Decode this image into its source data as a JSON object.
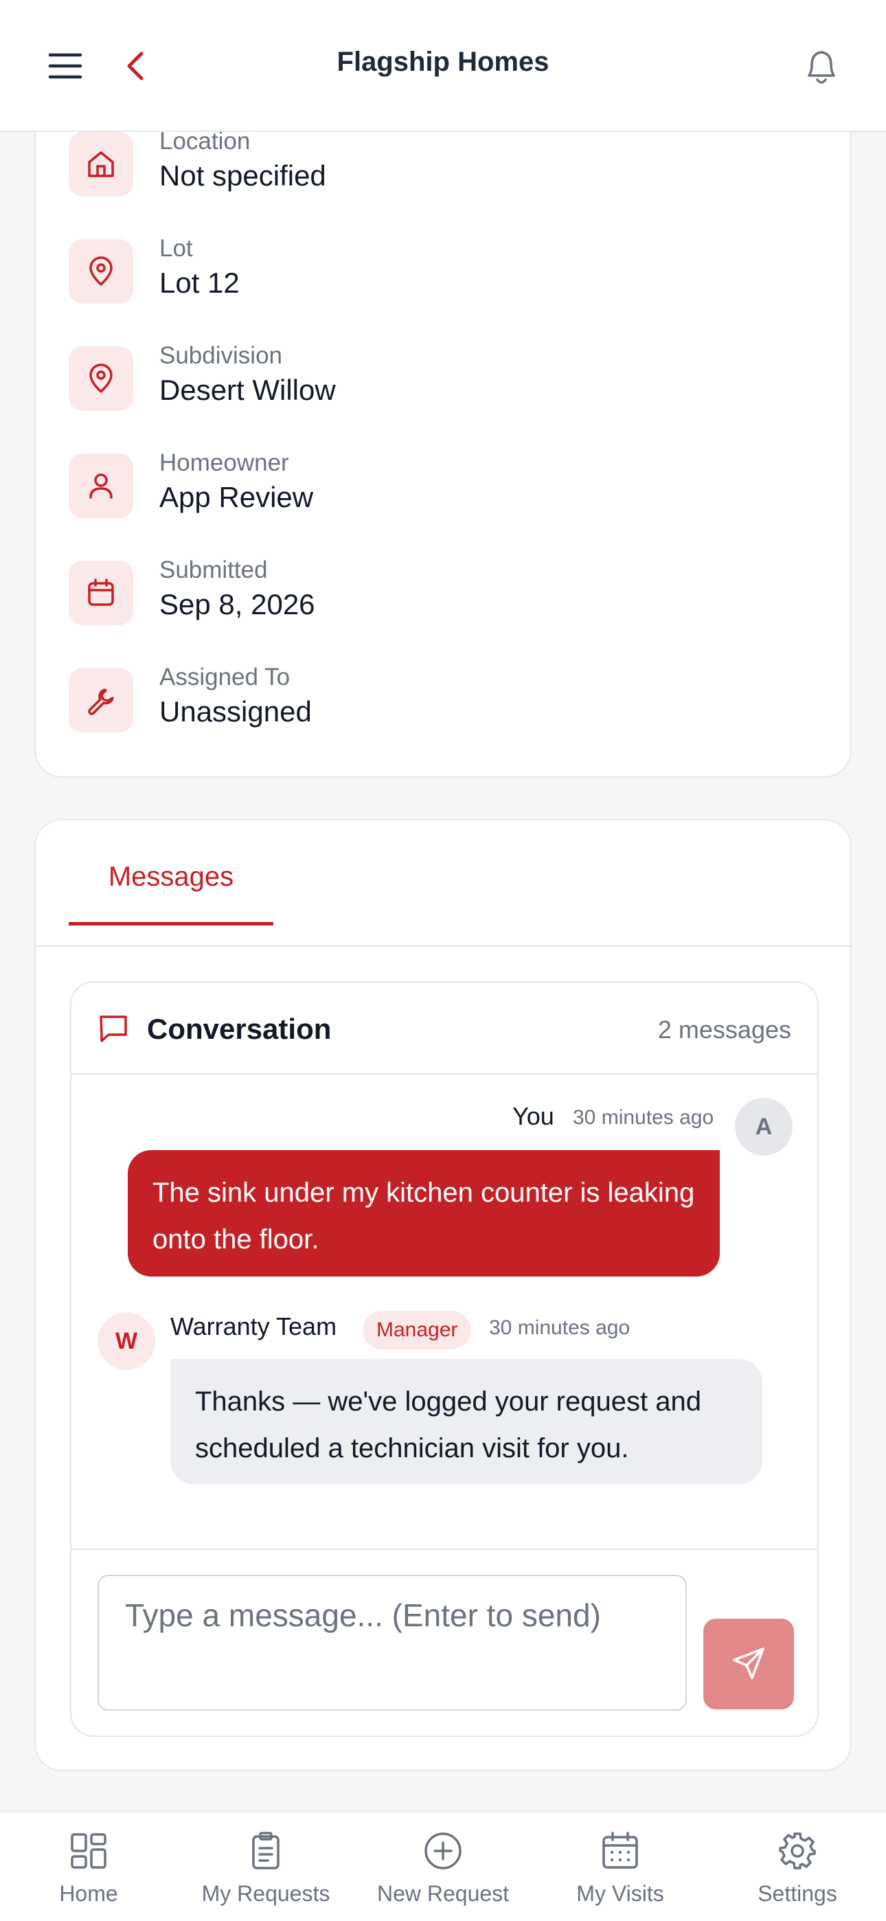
{
  "header": {
    "title": "Flagship Homes",
    "menu_icon": "hamburger-icon",
    "back_icon": "chevron-left-icon",
    "bell_icon": "bell-icon"
  },
  "details": [
    {
      "label": "Location",
      "value": "Not specified",
      "icon": "home-icon"
    },
    {
      "label": "Lot",
      "value": "Lot 12",
      "icon": "map-pin-icon"
    },
    {
      "label": "Subdivision",
      "value": "Desert Willow",
      "icon": "map-pin-icon"
    },
    {
      "label": "Homeowner",
      "value": "App Review",
      "icon": "user-icon"
    },
    {
      "label": "Submitted",
      "value": "Sep 8, 2026",
      "icon": "calendar-icon"
    },
    {
      "label": "Assigned To",
      "value": "Unassigned",
      "icon": "wrench-icon"
    }
  ],
  "messages": {
    "tab_label": "Messages",
    "conversation": {
      "title": "Conversation",
      "count": "2 messages",
      "icon": "message-square-icon"
    },
    "items": [
      {
        "sender": "You",
        "time": "30 minutes ago",
        "avatar": "A",
        "text": "The sink under my kitchen counter is leaking onto the floor."
      },
      {
        "sender": "Warranty Team",
        "role": "Manager",
        "time": "30 minutes ago",
        "avatar": "W",
        "text": "Thanks — we've logged your request and scheduled a technician visit for you."
      }
    ],
    "input_placeholder": "Type a message... (Enter to send)",
    "send_icon": "send-icon"
  },
  "nav": [
    {
      "label": "Home",
      "icon": "dashboard-icon"
    },
    {
      "label": "My Requests",
      "icon": "clipboard-icon"
    },
    {
      "label": "New Request",
      "icon": "plus-circle-icon"
    },
    {
      "label": "My Visits",
      "icon": "calendar-icon"
    },
    {
      "label": "Settings",
      "icon": "gear-icon"
    }
  ],
  "colors": {
    "accent": "#c42126",
    "accent_light": "#fbe9e9",
    "send_disabled": "#e38888",
    "text": "#111827",
    "muted": "#6b7280"
  }
}
